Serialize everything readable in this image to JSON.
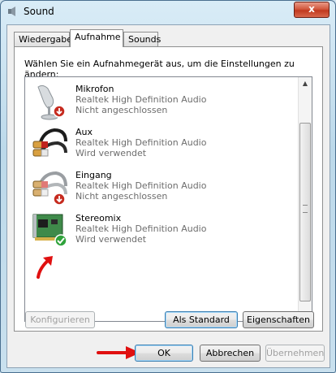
{
  "window": {
    "title": "Sound",
    "close_glyph": "x"
  },
  "tabs": [
    {
      "label": "Wiedergabe",
      "active": false
    },
    {
      "label": "Aufnahme",
      "active": true
    },
    {
      "label": "Sounds",
      "active": false
    }
  ],
  "instruction": "Wählen Sie ein Aufnahmegerät aus, um die Einstellungen zu ändern:",
  "devices": [
    {
      "name": "Mikrofon",
      "driver": "Realtek High Definition Audio",
      "status": "Nicht angeschlossen",
      "icon": "microphone-icon",
      "badge": "disconnected"
    },
    {
      "name": "Aux",
      "driver": "Realtek High Definition Audio",
      "status": "Wird verwendet",
      "icon": "cable-icon",
      "badge": "none"
    },
    {
      "name": "Eingang",
      "driver": "Realtek High Definition Audio",
      "status": "Nicht angeschlossen",
      "icon": "cable-icon",
      "badge": "disconnected"
    },
    {
      "name": "Stereomix",
      "driver": "Realtek High Definition Audio",
      "status": "Wird verwendet",
      "icon": "sound-card-icon",
      "badge": "default-check"
    }
  ],
  "panel_buttons": {
    "configure": "Konfigurieren",
    "set_default": "Als Standard",
    "properties": "Eigenschaften"
  },
  "dialog_buttons": {
    "ok": "OK",
    "cancel": "Abbrechen",
    "apply": "Übernehmen"
  },
  "colors": {
    "annotation_arrow": "#e01010",
    "accent": "#3c7fb1"
  }
}
